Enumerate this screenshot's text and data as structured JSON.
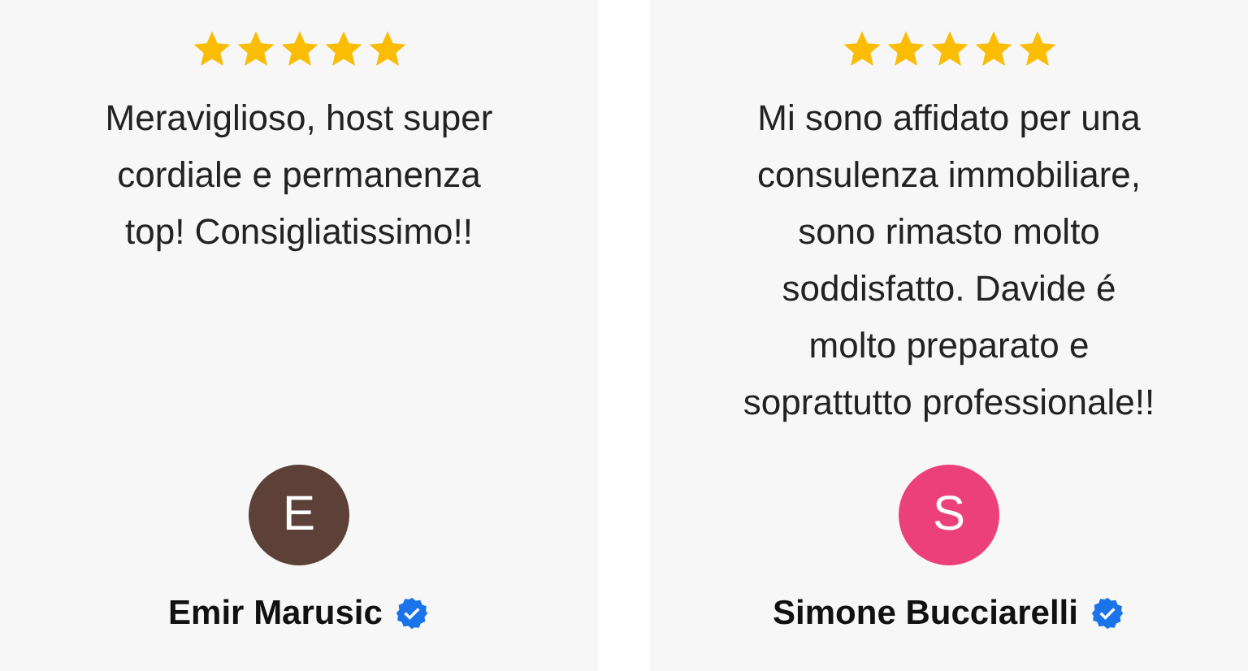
{
  "reviews": [
    {
      "stars": 5,
      "text": "Meraviglioso, host super cordiale e permanenza top! Consigliatissimo!!",
      "avatar": {
        "initial": "E",
        "color": "#5d4037"
      },
      "name": "Emir Marusic",
      "verified": true
    },
    {
      "stars": 5,
      "text": "Mi sono affidato per una consulenza immobiliare, sono rimasto molto soddisfatto. Davide é molto preparato e soprattutto professionale!!",
      "avatar": {
        "initial": "S",
        "color": "#ec407a"
      },
      "name": "Simone Bucciarelli",
      "verified": true
    }
  ]
}
